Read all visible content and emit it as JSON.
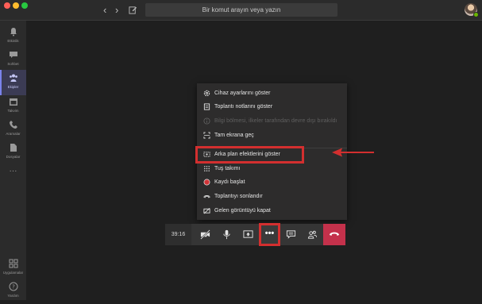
{
  "titlebar": {
    "search_placeholder": "Bir komut arayın veya yazın"
  },
  "sidebar": {
    "items": [
      {
        "label": "Etkinlik",
        "icon": "bell-icon"
      },
      {
        "label": "Sohbet",
        "icon": "chat-icon"
      },
      {
        "label": "Ekipler",
        "icon": "teams-icon",
        "active": true
      },
      {
        "label": "Takvim",
        "icon": "calendar-icon"
      },
      {
        "label": "Aramalar",
        "icon": "phone-icon"
      },
      {
        "label": "Dosyalar",
        "icon": "file-icon"
      }
    ],
    "more": "···",
    "bottom": [
      {
        "label": "Uygulamalar",
        "icon": "apps-icon"
      },
      {
        "label": "Yardım",
        "icon": "help-icon"
      }
    ]
  },
  "menu": {
    "items": [
      {
        "label": "Cihaz ayarlarını göster",
        "icon": "gear-icon",
        "enabled": true
      },
      {
        "label": "Toplantı notlarını göster",
        "icon": "notes-icon",
        "enabled": true
      },
      {
        "label": "Bilgi bölmesi, ilkeler tarafından devre dışı bırakıldı",
        "icon": "info-icon",
        "enabled": false
      },
      {
        "label": "Tam ekrana geç",
        "icon": "fullscreen-icon",
        "enabled": true
      },
      {
        "label": "Arka plan efektlerini göster",
        "icon": "background-effects-icon",
        "enabled": true,
        "highlighted": true
      },
      {
        "label": "Tuş takımı",
        "icon": "keypad-icon",
        "enabled": true
      },
      {
        "label": "Kaydı başlat",
        "icon": "record-icon",
        "enabled": true
      },
      {
        "label": "Toplantıyı sonlandır",
        "icon": "end-meeting-icon",
        "enabled": true
      },
      {
        "label": "Gelen görüntüyü kapat",
        "icon": "video-off-icon",
        "enabled": true
      }
    ]
  },
  "toolbar": {
    "timer": "39:16",
    "more_label": "•••",
    "buttons": [
      "camera-off-icon",
      "mic-icon",
      "share-screen-icon",
      "more-options-icon",
      "chat-icon",
      "participants-icon",
      "hangup-icon"
    ]
  },
  "colors": {
    "accent": "#7b83eb",
    "highlight": "#d32f2f",
    "hangup": "#c4314b",
    "record": "#d13438"
  }
}
